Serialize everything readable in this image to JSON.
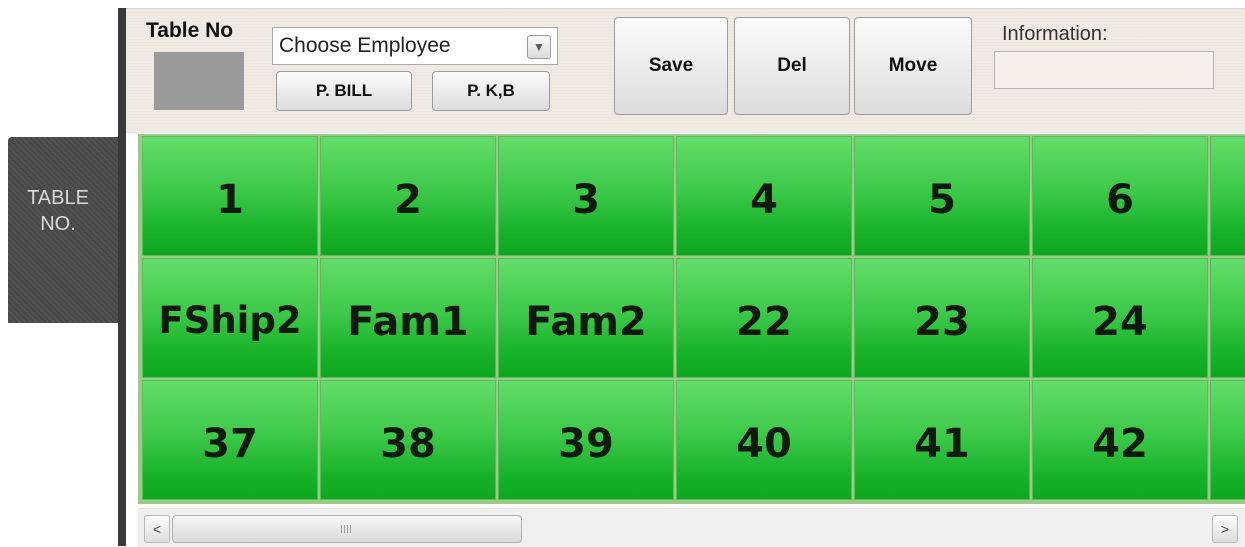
{
  "sidebar": {
    "tab_label": "TABLE NO."
  },
  "toolbar": {
    "table_no_label": "Table No",
    "employee_select_value": "Choose Employee",
    "print_bill_label": "P. BILL",
    "print_kb_label": "P. K,B",
    "save_label": "Save",
    "delete_label": "Del",
    "move_label": "Move",
    "information_label": "Information:",
    "information_value": ""
  },
  "tables": {
    "rows": [
      [
        "1",
        "2",
        "3",
        "4",
        "5",
        "6"
      ],
      [
        "FShip2",
        "Fam1",
        "Fam2",
        "22",
        "23",
        "24"
      ],
      [
        "37",
        "38",
        "39",
        "40",
        "41",
        "42"
      ]
    ]
  },
  "scrollbar": {
    "left_arrow": "<",
    "right_arrow": ">"
  },
  "colors": {
    "tile_green": "#3ec94a",
    "toolbar_bg": "#efebe4",
    "sidebar_bg": "#4a4a4a"
  }
}
